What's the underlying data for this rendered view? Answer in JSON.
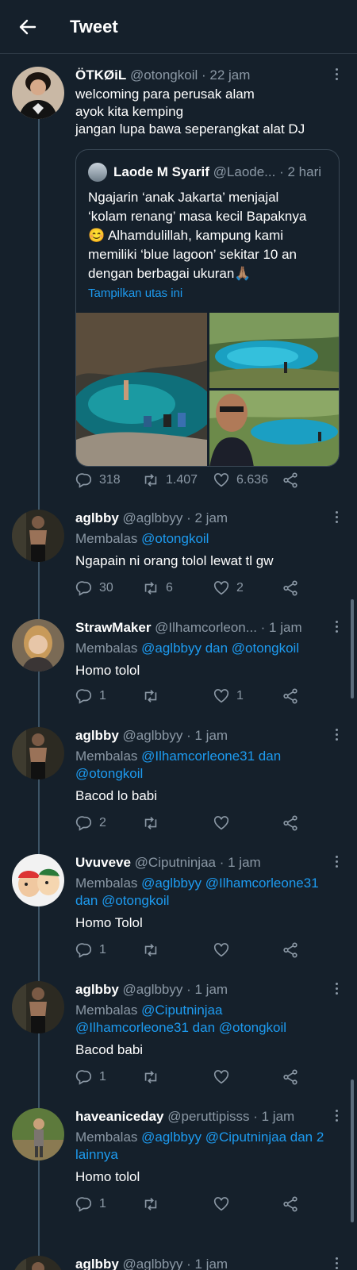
{
  "header": {
    "title": "Tweet",
    "back_icon": "arrow-left-icon"
  },
  "main_tweet": {
    "name": "ÖTKØiL",
    "handle": "@otongkoil",
    "time": "· 22 jam",
    "lines": [
      "welcoming para perusak alam",
      "ayok kita kemping",
      "jangan lupa bawa seperangkat alat DJ"
    ],
    "quote": {
      "name": "Laode M Syarif",
      "handle": "@Laode...",
      "time": "· 2 hari",
      "lines": [
        "Ngajarin ‘anak Jakarta’ menjajal",
        "‘kolam renang’ masa kecil Bapaknya",
        "😊 Alhamdulillah, kampung kami",
        "memiliki ‘blue lagoon’ sekitar 10 an",
        "dengan berbagai ukuran🙏🏽"
      ],
      "thread_link": "Tampilkan utas ini"
    },
    "stats": {
      "replies": "318",
      "retweets": "1.407",
      "likes": "6.636"
    }
  },
  "replies": [
    {
      "name": "aglbby",
      "handle": "@aglbbyy",
      "time": "· 2 jam",
      "reply_prefix": "Membalas ",
      "reply_to": [
        "@otongkoil"
      ],
      "text": "Ngapain ni orang tolol lewat tl gw",
      "replies": "30",
      "retweets": "6",
      "likes": "2"
    },
    {
      "name": "StrawMaker",
      "handle": "@Ilhamcorleon...",
      "time": "· 1 jam",
      "reply_prefix": "Membalas ",
      "reply_to": [
        "@aglbbyy dan @otongkoil"
      ],
      "text": "Homo tolol",
      "replies": "1",
      "retweets": "",
      "likes": "1"
    },
    {
      "name": "aglbby",
      "handle": "@aglbbyy",
      "time": "· 1 jam",
      "reply_prefix": "Membalas ",
      "reply_to": [
        "@Ilhamcorleone31 dan",
        "@otongkoil"
      ],
      "text": "Bacod lo babi",
      "replies": "2",
      "retweets": "",
      "likes": ""
    },
    {
      "name": "Uvuveve",
      "handle": "@Ciputninjaa",
      "time": "· 1 jam",
      "reply_prefix": "Membalas ",
      "reply_to": [
        "@aglbbyy @Ilhamcorleone31",
        "dan @otongkoil"
      ],
      "text": "Homo Tolol",
      "replies": "1",
      "retweets": "",
      "likes": ""
    },
    {
      "name": "aglbby",
      "handle": "@aglbbyy",
      "time": "· 1 jam",
      "reply_prefix": "Membalas ",
      "reply_to": [
        "@Ciputninjaa",
        "@Ilhamcorleone31 dan @otongkoil"
      ],
      "text": "Bacod babi",
      "replies": "1",
      "retweets": "",
      "likes": ""
    },
    {
      "name": "haveaniceday",
      "handle": "@peruttipisss",
      "time": "· 1 jam",
      "reply_prefix": "Membalas ",
      "reply_to": [
        "@aglbbyy @Ciputninjaa dan 2",
        "lainnya"
      ],
      "text": "Homo tolol",
      "replies": "1",
      "retweets": "",
      "likes": ""
    },
    {
      "name": "aglbby",
      "handle": "@aglbbyy",
      "time": "· 1 jam",
      "reply_prefix": "",
      "reply_to": [],
      "text": "",
      "replies": "",
      "retweets": "",
      "likes": ""
    }
  ]
}
